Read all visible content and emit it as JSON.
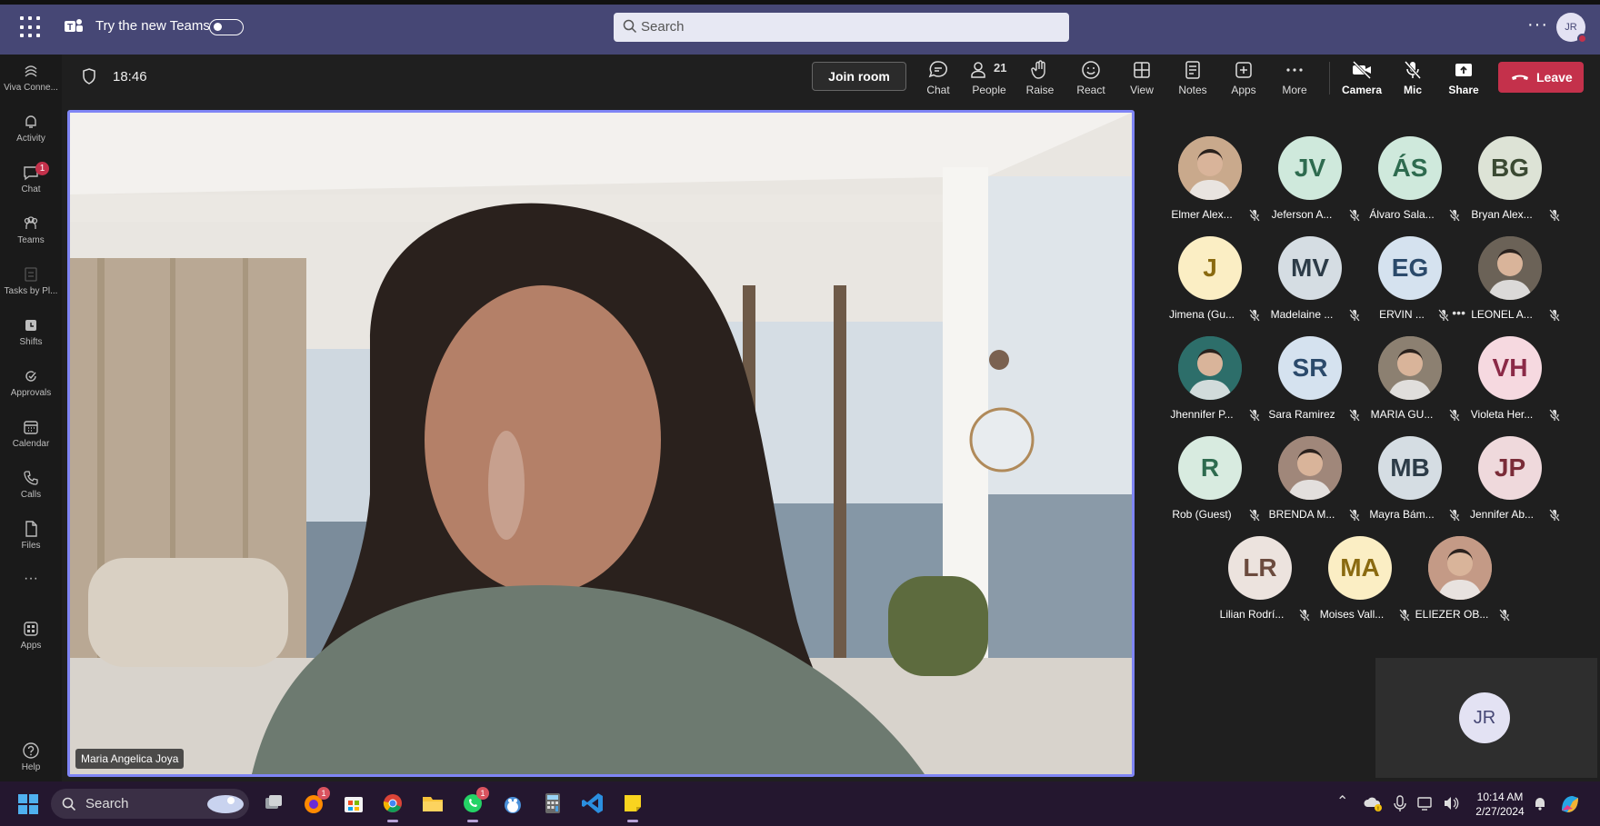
{
  "topbar": {
    "try_new_label": "Try the new Teams",
    "search_placeholder": "Search",
    "more_label": "···",
    "user_initials": "JR"
  },
  "rail": [
    {
      "label": "Viva Conne...",
      "icon": "viva-connections-icon"
    },
    {
      "label": "Activity",
      "icon": "bell-icon"
    },
    {
      "label": "Chat",
      "icon": "chat-icon",
      "badge": "1"
    },
    {
      "label": "Teams",
      "icon": "teams-icon"
    },
    {
      "label": "Tasks by Pl...",
      "icon": "tasks-icon"
    },
    {
      "label": "Shifts",
      "icon": "shifts-icon"
    },
    {
      "label": "Approvals",
      "icon": "approvals-icon"
    },
    {
      "label": "Calendar",
      "icon": "calendar-icon"
    },
    {
      "label": "Calls",
      "icon": "phone-icon"
    },
    {
      "label": "Files",
      "icon": "file-icon"
    },
    {
      "label": "···",
      "icon": "more-icon"
    },
    {
      "label": "Apps",
      "icon": "apps-icon"
    },
    {
      "label": "Help",
      "icon": "help-icon"
    }
  ],
  "callbar": {
    "timer": "18:46",
    "join_room": "Join room",
    "chat": "Chat",
    "people": "People",
    "people_count": "21",
    "raise": "Raise",
    "react": "React",
    "view": "View",
    "notes": "Notes",
    "apps": "Apps",
    "more": "More",
    "camera": "Camera",
    "mic": "Mic",
    "share": "Share",
    "leave": "Leave"
  },
  "stage": {
    "speaker_name": "Maria Angelica Joya"
  },
  "participants": [
    {
      "name": "Elmer Alex...",
      "photo": true,
      "bg": "#c9a98c"
    },
    {
      "name": "Jeferson A...",
      "initials": "JV",
      "bg": "#cfe9dc",
      "fg": "#2e6b4f"
    },
    {
      "name": "Álvaro Sala...",
      "initials": "ÁS",
      "bg": "#cfe9dc",
      "fg": "#2e6b4f"
    },
    {
      "name": "Bryan Alex...",
      "initials": "BG",
      "bg": "#dde3d6",
      "fg": "#3b4a33"
    },
    {
      "name": "Jimena (Gu...",
      "initials": "J",
      "bg": "#fbeec4",
      "fg": "#8a6a10"
    },
    {
      "name": "Madelaine ...",
      "initials": "MV",
      "bg": "#d5dde3",
      "fg": "#2d3c48"
    },
    {
      "name": "ERVIN ...",
      "initials": "EG",
      "bg": "#d5e2ef",
      "fg": "#2b4a6b",
      "more": true
    },
    {
      "name": "LEONEL A...",
      "photo": true,
      "bg": "#6b6257"
    },
    {
      "name": "Jhennifer P...",
      "photo": true,
      "bg": "#2d6e6a"
    },
    {
      "name": "Sara Ramirez",
      "initials": "SR",
      "bg": "#d5e2ef",
      "fg": "#2b4a6b"
    },
    {
      "name": "MARIA GU...",
      "photo": true,
      "bg": "#8c8071"
    },
    {
      "name": "Violeta Her...",
      "initials": "VH",
      "bg": "#f6d9e0",
      "fg": "#8b2a47"
    },
    {
      "name": "Rob (Guest)",
      "initials": "R",
      "bg": "#d8ebe0",
      "fg": "#2e6b4f"
    },
    {
      "name": "BRENDA M...",
      "photo": true,
      "bg": "#a0877a"
    },
    {
      "name": "Mayra Bám...",
      "initials": "MB",
      "bg": "#d5dde3",
      "fg": "#2d3c48"
    },
    {
      "name": "Jennifer Ab...",
      "initials": "JP",
      "bg": "#efd9dc",
      "fg": "#7a2c38"
    },
    {
      "name": "Lilian Rodrí...",
      "initials": "LR",
      "bg": "#ece3de",
      "fg": "#6b4b3e"
    },
    {
      "name": "Moises Vall...",
      "initials": "MA",
      "bg": "#fbeec4",
      "fg": "#8a6a10"
    },
    {
      "name": "ELIEZER OB...",
      "photo": true,
      "bg": "#c49a86"
    }
  ],
  "self_view": {
    "initials": "JR"
  },
  "taskbar": {
    "search_label": "Search",
    "time": "10:14 AM",
    "date": "2/27/2024",
    "badge_firefox": "1",
    "badge_whatsapp": "1"
  }
}
